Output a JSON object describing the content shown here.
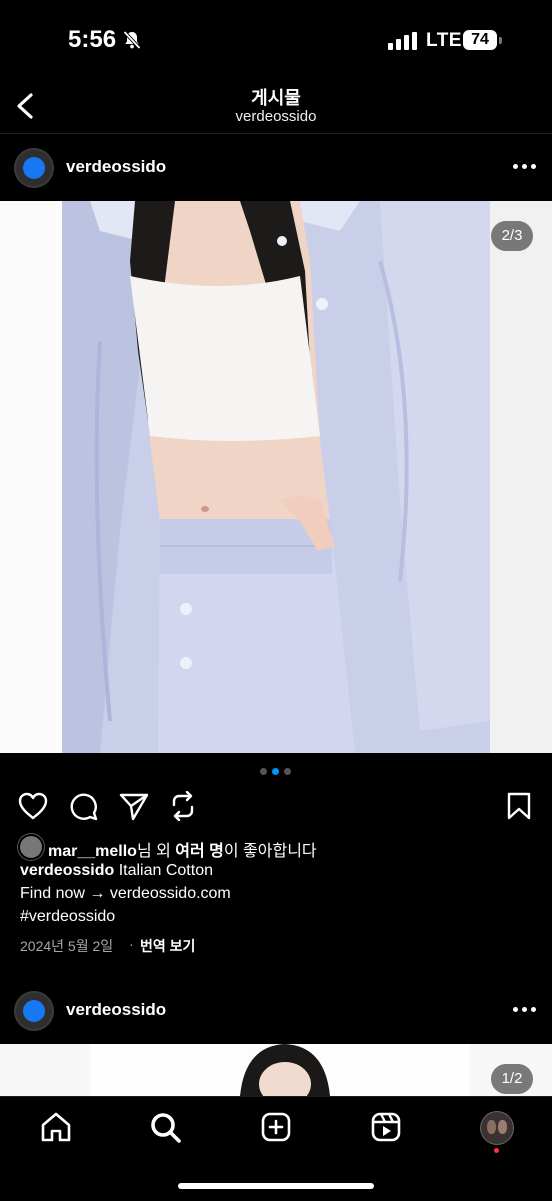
{
  "status_bar": {
    "time": "5:56",
    "network": "LTE",
    "battery": "74"
  },
  "header": {
    "title": "게시물",
    "subtitle": "verdeossido"
  },
  "post": {
    "username": "verdeossido",
    "image_counter": "2/3",
    "likes": {
      "user": "mar__mello",
      "suffix_1": "님 외 ",
      "bold": "여러 명",
      "suffix_2": "이 좋아합니다"
    },
    "caption": {
      "username": "verdeossido",
      "text": " Italian Cotton"
    },
    "caption_line2": "Find now → verdeossido.com",
    "caption_line3": "#verdeossido",
    "date": "2024년 5월 2일",
    "separator": "·",
    "translate": "번역 보기"
  },
  "next_post": {
    "username": "verdeossido",
    "image_counter": "1/2"
  },
  "icons": {
    "actions": [
      "heart-icon",
      "comment-icon",
      "share-icon",
      "repost-icon",
      "bookmark-icon"
    ],
    "tabs": [
      "home-icon",
      "search-icon",
      "create-icon",
      "reels-icon",
      "profile-avatar"
    ]
  },
  "colors": {
    "accent": "#0095f6",
    "avatar": "#1877f2",
    "background": "#000000"
  }
}
